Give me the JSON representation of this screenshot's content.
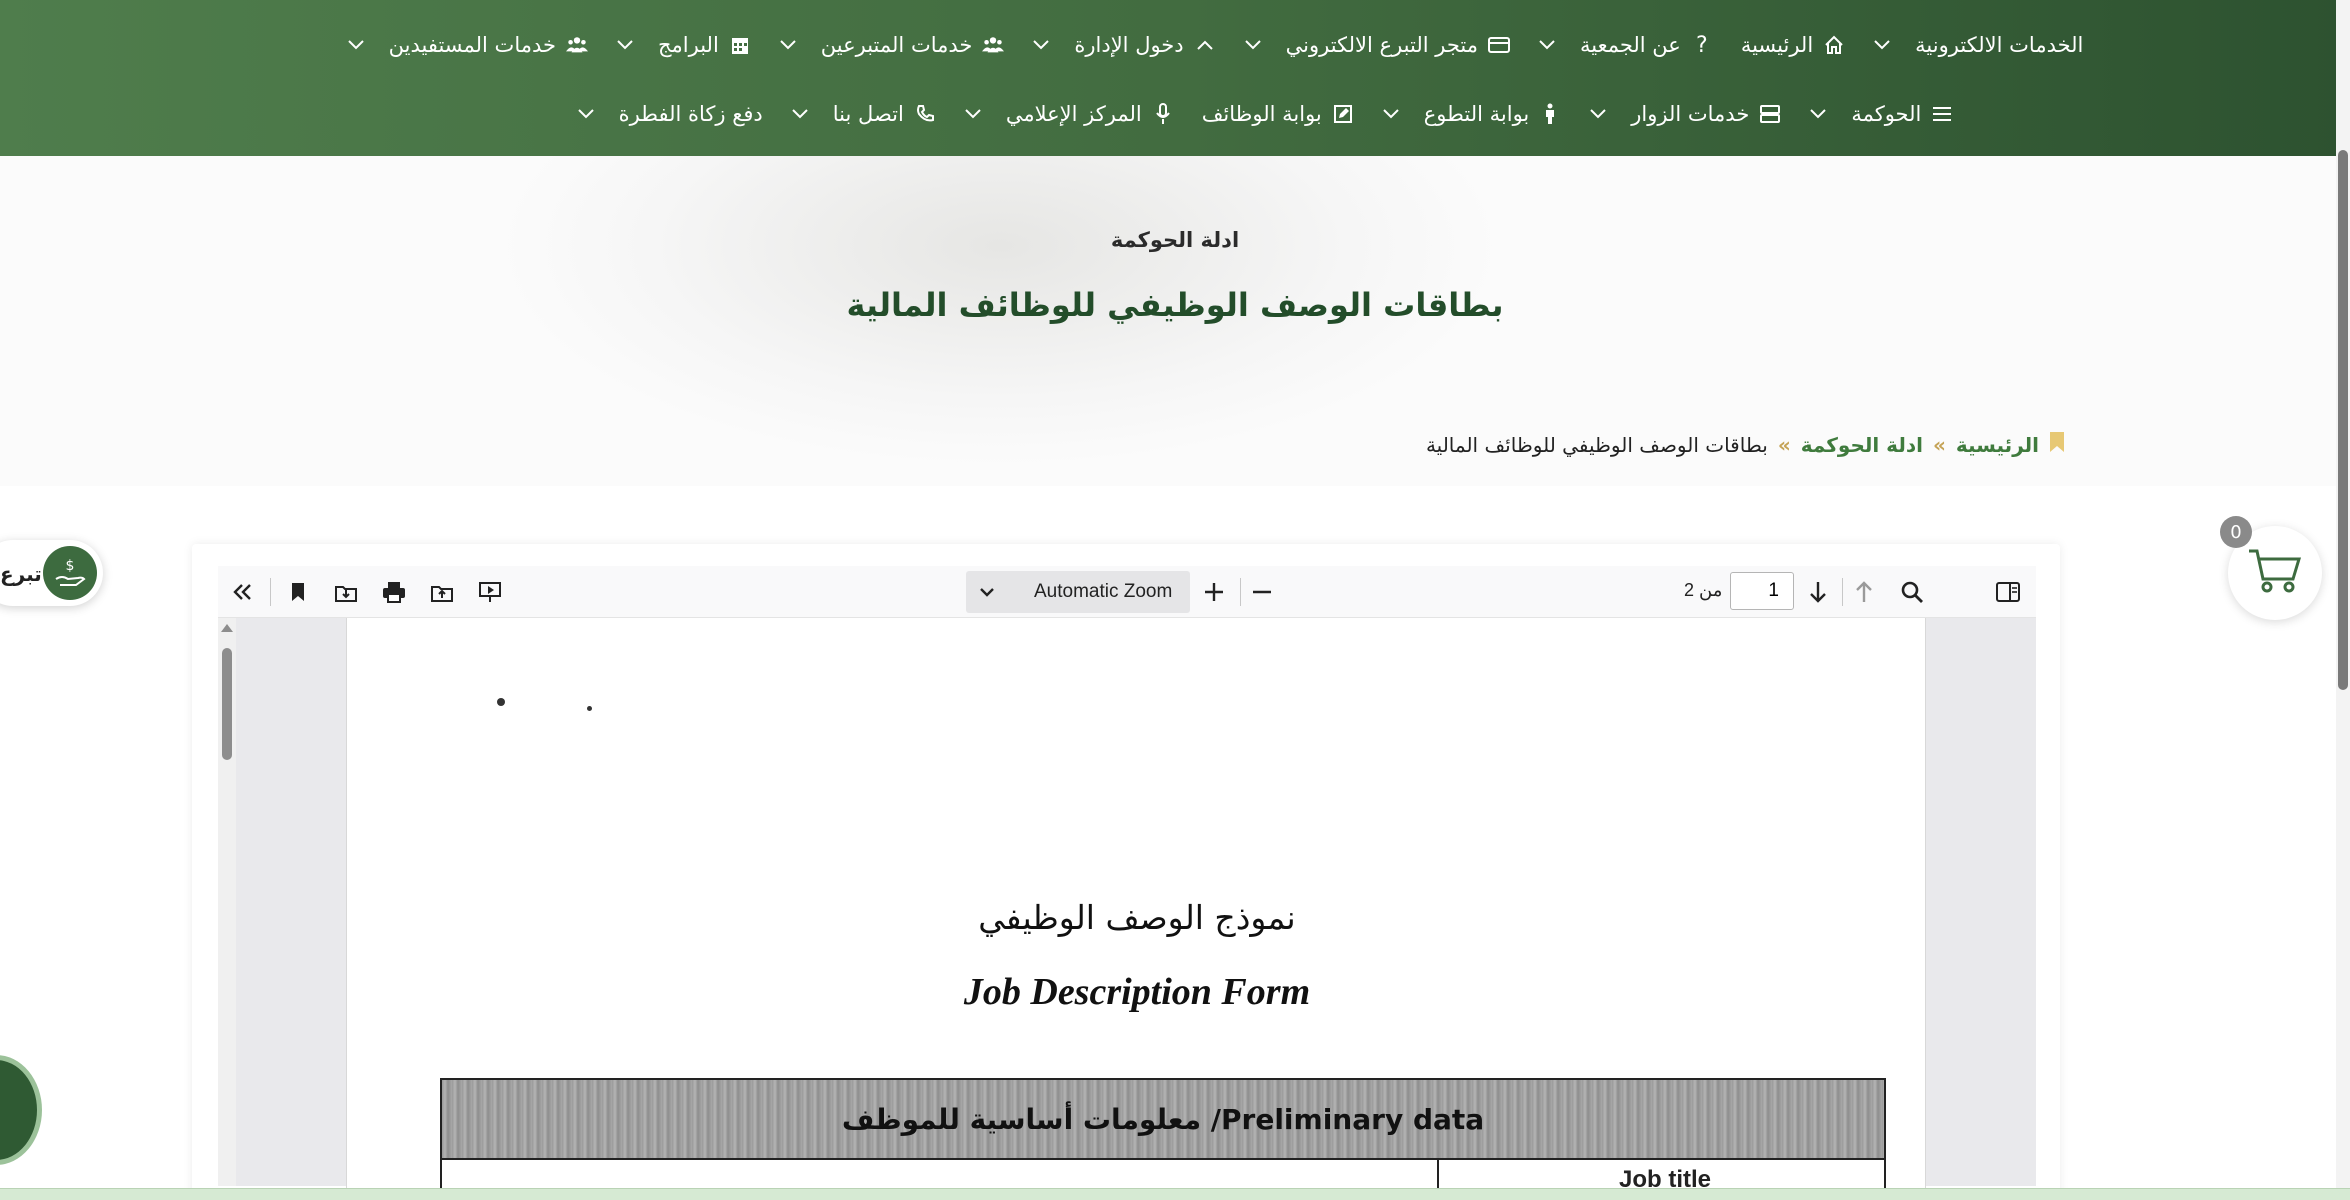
{
  "nav": {
    "row1": [
      {
        "label": "الخدمات الالكترونية",
        "icon": "none",
        "dropdown": true
      },
      {
        "label": "الرئيسية",
        "icon": "home-icon",
        "dropdown": false
      },
      {
        "label": "عن الجمعية",
        "icon": "question-icon",
        "dropdown": true
      },
      {
        "label": "متجر التبرع الالكتروني",
        "icon": "card-icon",
        "dropdown": true
      },
      {
        "label": "دخول الإدارة",
        "icon": "chevron-up-icon",
        "dropdown": true
      },
      {
        "label": "خدمات المتبرعين",
        "icon": "users-icon",
        "dropdown": true
      },
      {
        "label": "البرامج",
        "icon": "calendar-icon",
        "dropdown": true
      },
      {
        "label": "خدمات المستفيدين",
        "icon": "users-icon",
        "dropdown": true
      }
    ],
    "row2": [
      {
        "label": "الحوكمة",
        "icon": "menu-icon",
        "dropdown": true
      },
      {
        "label": "خدمات الزوار",
        "icon": "server-icon",
        "dropdown": true
      },
      {
        "label": "بوابة التطوع",
        "icon": "person-icon",
        "dropdown": true
      },
      {
        "label": "بوابة الوظائف",
        "icon": "edit-icon",
        "dropdown": false
      },
      {
        "label": "المركز الإعلامي",
        "icon": "mic-icon",
        "dropdown": true
      },
      {
        "label": "اتصل بنا",
        "icon": "phone-icon",
        "dropdown": true
      },
      {
        "label": "دفع زكاة الفطرة",
        "icon": "none",
        "dropdown": true
      }
    ]
  },
  "hero": {
    "subtitle": "ادلة الحوكمة",
    "title": "بطاقات الوصف الوظيفي للوظائف المالية"
  },
  "breadcrumb": {
    "home": "الرئيسية",
    "sep": "»",
    "parent": "ادلة الحوكمة",
    "current": "بطاقات الوصف الوظيفي للوظائف المالية"
  },
  "donate": {
    "label": "تبرع"
  },
  "cart": {
    "count": "0"
  },
  "viewer": {
    "zoom": "Automatic Zoom",
    "page_number": "1",
    "page_of": "من 2",
    "toolbar_icons": [
      "sidebar-toggle-icon",
      "search-icon",
      "prev-page-icon",
      "next-page-icon",
      "zoom-out-icon",
      "zoom-in-icon",
      "presentation-icon",
      "open-file-icon",
      "print-icon",
      "download-icon",
      "bookmark-icon",
      "tools-icon"
    ]
  },
  "pdf": {
    "title_ar": "نموذج الوصف الوظيفي",
    "title_en": "Job Description Form",
    "table_header": "Preliminary data/ معلومات أساسية للموظف",
    "job_title_label": "Job title"
  },
  "colors": {
    "nav_start": "#4f7d4c",
    "nav_end": "#2d5230",
    "accent_green": "#3f7b3d",
    "breadcrumb_sep": "#c5a356"
  }
}
